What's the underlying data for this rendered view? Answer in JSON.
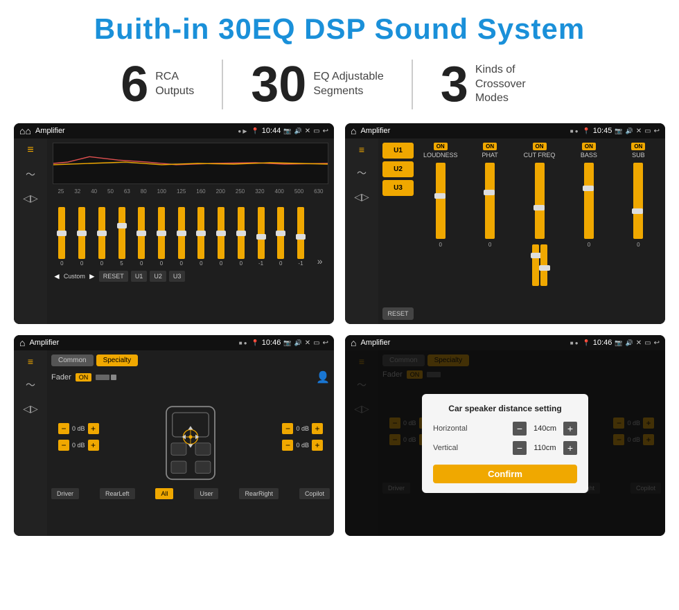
{
  "page": {
    "title": "Buith-in 30EQ DSP Sound System"
  },
  "stats": [
    {
      "number": "6",
      "line1": "RCA",
      "line2": "Outputs"
    },
    {
      "number": "30",
      "line1": "EQ Adjustable",
      "line2": "Segments"
    },
    {
      "number": "3",
      "line1": "Kinds of",
      "line2": "Crossover Modes"
    }
  ],
  "screens": [
    {
      "id": "screen1",
      "statusBar": {
        "title": "Amplifier",
        "time": "10:44"
      },
      "type": "eq"
    },
    {
      "id": "screen2",
      "statusBar": {
        "title": "Amplifier",
        "time": "10:45"
      },
      "type": "crossover"
    },
    {
      "id": "screen3",
      "statusBar": {
        "title": "Amplifier",
        "time": "10:46"
      },
      "type": "fader"
    },
    {
      "id": "screen4",
      "statusBar": {
        "title": "Amplifier",
        "time": "10:46"
      },
      "type": "fader-dialog"
    }
  ],
  "eq": {
    "freqLabels": [
      "25",
      "32",
      "40",
      "50",
      "63",
      "80",
      "100",
      "125",
      "160",
      "200",
      "250",
      "320",
      "400",
      "500",
      "630"
    ],
    "values": [
      "0",
      "0",
      "0",
      "5",
      "0",
      "0",
      "0",
      "0",
      "0",
      "0",
      "-1",
      "0",
      "-1"
    ],
    "preset": "Custom",
    "buttons": [
      "RESET",
      "U1",
      "U2",
      "U3"
    ]
  },
  "crossover": {
    "channels": [
      "LOUDNESS",
      "PHAT",
      "CUT FREQ",
      "BASS",
      "SUB"
    ],
    "presets": [
      "U1",
      "U2",
      "U3"
    ],
    "resetLabel": "RESET"
  },
  "fader": {
    "tabs": [
      "Common",
      "Specialty"
    ],
    "faderLabel": "Fader",
    "onLabel": "ON",
    "volumes": [
      "0 dB",
      "0 dB",
      "0 dB",
      "0 dB"
    ],
    "buttons": [
      "Driver",
      "RearLeft",
      "All",
      "User",
      "RearRight",
      "Copilot"
    ]
  },
  "dialog": {
    "title": "Car speaker distance setting",
    "horizontal": {
      "label": "Horizontal",
      "value": "140cm"
    },
    "vertical": {
      "label": "Vertical",
      "value": "110cm"
    },
    "confirmLabel": "Confirm"
  }
}
